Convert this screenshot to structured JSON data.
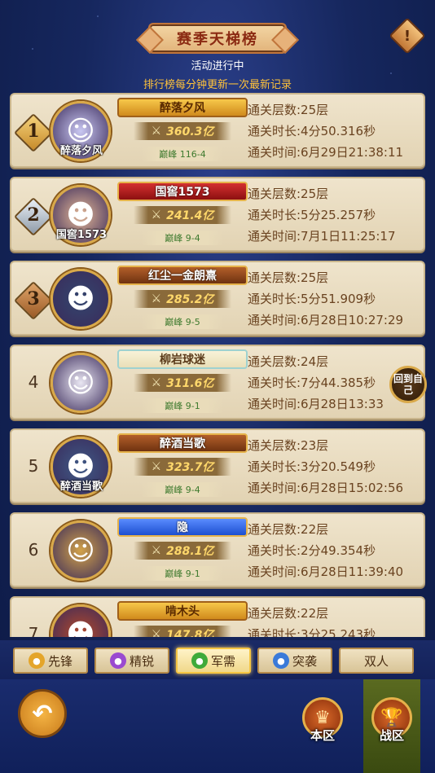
{
  "header": {
    "title": "赛季天梯榜",
    "status": "活动进行中",
    "update_note": "排行榜每分钟更新一次最新记录",
    "info_icon": "!"
  },
  "ranking": [
    {
      "rank": "1",
      "badge": "gold",
      "name": "醉落夕风",
      "avatar_label": "醉落夕风",
      "banner_style": "nb-gold",
      "power": "360.3亿",
      "tier": "巅峰 116-4",
      "floors": "通关层数:25层",
      "duration": "通关时长:4分50.316秒",
      "time": "通关时间:6月29日21:38:11",
      "avatar_color": "#c9c7f2",
      "avatar_face": "☺"
    },
    {
      "rank": "2",
      "badge": "silver",
      "name": "国窖1573",
      "avatar_label": "国窖1573",
      "banner_style": "nb-red",
      "power": "241.4亿",
      "tier": "巅峰 9-4",
      "floors": "通关层数:25层",
      "duration": "通关时长:5分25.257秒",
      "time": "通关时间:7月1日11:25:17",
      "avatar_color": "#e4b896",
      "avatar_face": "☻"
    },
    {
      "rank": "3",
      "badge": "bronze",
      "name": "红尘一金朗熹",
      "avatar_label": "",
      "banner_style": "nb-brown",
      "power": "285.2亿",
      "tier": "巅峰 9-5",
      "floors": "通关层数:25层",
      "duration": "通关时长:5分51.909秒",
      "time": "通关时间:6月28日10:27:29",
      "avatar_color": "#34466e",
      "avatar_face": "☻"
    },
    {
      "rank": "4",
      "badge": "",
      "name": "柳岩球迷",
      "avatar_label": "",
      "banner_style": "nb-light",
      "power": "311.6亿",
      "tier": "巅峰 9-1",
      "floors": "通关层数:24层",
      "duration": "通关时长:7分44.385秒",
      "time": "通关时间:6月28日13:33",
      "avatar_color": "#e9e6f2",
      "avatar_face": "☺"
    },
    {
      "rank": "5",
      "badge": "",
      "name": "醉酒当歌",
      "avatar_label": "醉酒当歌",
      "banner_style": "nb-brown",
      "power": "323.7亿",
      "tier": "巅峰 9-4",
      "floors": "通关层数:23层",
      "duration": "通关时长:3分20.549秒",
      "time": "通关时间:6月28日15:02:56",
      "avatar_color": "#3f5a86",
      "avatar_face": "☻"
    },
    {
      "rank": "6",
      "badge": "",
      "name": "隐",
      "avatar_label": "",
      "banner_style": "nb-blue",
      "power": "288.1亿",
      "tier": "巅峰 9-1",
      "floors": "通关层数:22层",
      "duration": "通关时长:2分49.354秒",
      "time": "通关时间:6月28日11:39:40",
      "avatar_color": "#d2a24a",
      "avatar_face": "☺"
    },
    {
      "rank": "7",
      "badge": "",
      "name": "啃木头",
      "avatar_label": "",
      "banner_style": "nb-gold",
      "power": "147.8亿",
      "tier": "",
      "floors": "通关层数:22层",
      "duration": "通关时长:3分25.243秒",
      "time": "",
      "avatar_color": "#b64a2a",
      "avatar_face": "☻"
    }
  ],
  "return_self": "回到自己",
  "tabs": [
    {
      "label": "先锋",
      "icon": "shield-icon",
      "color": "#e4a52a",
      "active": false
    },
    {
      "label": "精锐",
      "icon": "crystal-icon",
      "color": "#9a4ad0",
      "active": false
    },
    {
      "label": "军需",
      "icon": "leaf-icon",
      "color": "#3faa3a",
      "active": true
    },
    {
      "label": "突袭",
      "icon": "swirl-icon",
      "color": "#3a7ad9",
      "active": false
    },
    {
      "label": "双人",
      "icon": "",
      "color": "",
      "active": false
    }
  ],
  "bottom_nav": {
    "back_label": "↶",
    "local_label": "本区",
    "war_label": "战区"
  }
}
